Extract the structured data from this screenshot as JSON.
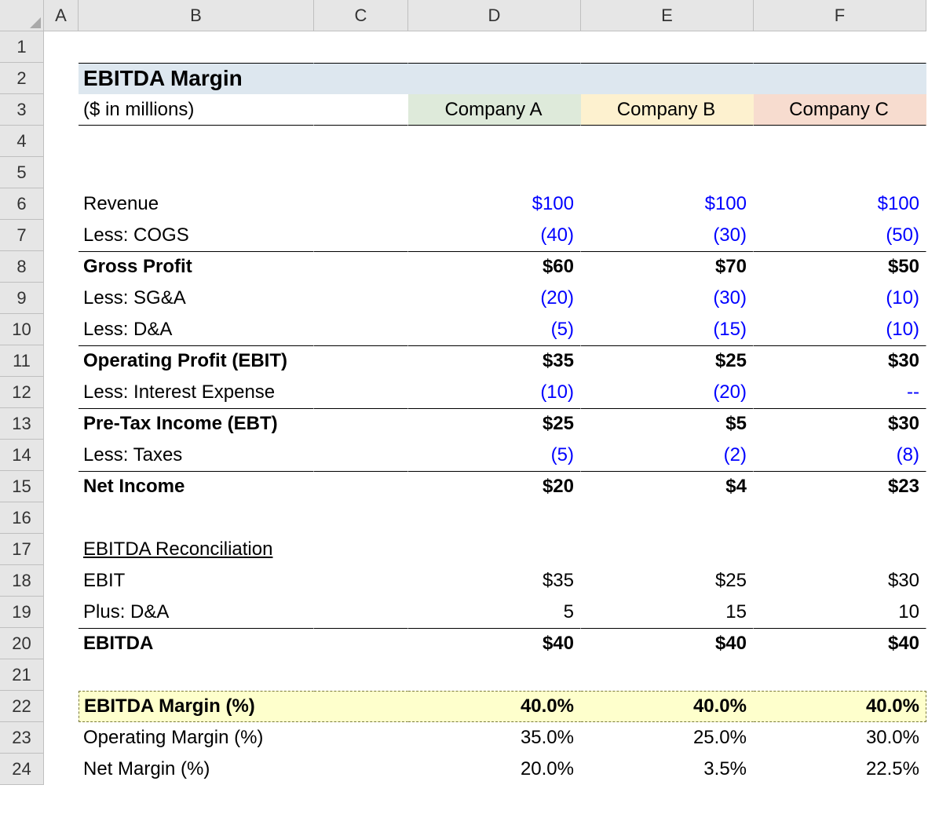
{
  "columns": [
    "A",
    "B",
    "C",
    "D",
    "E",
    "F"
  ],
  "rows": [
    "1",
    "2",
    "3",
    "4",
    "5",
    "6",
    "7",
    "8",
    "9",
    "10",
    "11",
    "12",
    "13",
    "14",
    "15",
    "16",
    "17",
    "18",
    "19",
    "20",
    "21",
    "22",
    "23",
    "24"
  ],
  "title": "EBITDA Margin",
  "subtitle": "($ in millions)",
  "companies": {
    "A": "Company A",
    "B": "Company B",
    "C": "Company C"
  },
  "lines": {
    "revenue": {
      "label": "Revenue",
      "A": "$100",
      "B": "$100",
      "C": "$100"
    },
    "cogs": {
      "label": "Less: COGS",
      "A": "(40)",
      "B": "(30)",
      "C": "(50)"
    },
    "gross": {
      "label": "Gross Profit",
      "A": "$60",
      "B": "$70",
      "C": "$50"
    },
    "sga": {
      "label": "Less: SG&A",
      "A": "(20)",
      "B": "(30)",
      "C": "(10)"
    },
    "da": {
      "label": "Less: D&A",
      "A": "(5)",
      "B": "(15)",
      "C": "(10)"
    },
    "ebit": {
      "label": "Operating Profit (EBIT)",
      "A": "$35",
      "B": "$25",
      "C": "$30"
    },
    "interest": {
      "label": "Less: Interest Expense",
      "A": "(10)",
      "B": "(20)",
      "C": "--"
    },
    "ebt": {
      "label": "Pre-Tax Income (EBT)",
      "A": "$25",
      "B": "$5",
      "C": "$30"
    },
    "taxes": {
      "label": "Less: Taxes",
      "A": "(5)",
      "B": "(2)",
      "C": "(8)"
    },
    "netincome": {
      "label": "Net Income",
      "A": "$20",
      "B": "$4",
      "C": "$23"
    },
    "recon_title": {
      "label": "EBITDA Reconciliation"
    },
    "recon_ebit": {
      "label": "EBIT",
      "A": "$35",
      "B": "$25",
      "C": "$30"
    },
    "recon_da": {
      "label": "Plus: D&A",
      "A": "5",
      "B": "15",
      "C": "10"
    },
    "ebitda": {
      "label": "EBITDA",
      "A": "$40",
      "B": "$40",
      "C": "$40"
    },
    "ebitda_margin": {
      "label": "EBITDA Margin (%)",
      "A": "40.0%",
      "B": "40.0%",
      "C": "40.0%"
    },
    "op_margin": {
      "label": "Operating Margin (%)",
      "A": "35.0%",
      "B": "25.0%",
      "C": "30.0%"
    },
    "net_margin": {
      "label": "Net Margin (%)",
      "A": "20.0%",
      "B": "3.5%",
      "C": "22.5%"
    }
  },
  "chart_data": {
    "type": "table",
    "title": "EBITDA Margin",
    "units": "$ in millions",
    "companies": [
      "Company A",
      "Company B",
      "Company C"
    ],
    "rows": [
      {
        "label": "Revenue",
        "values": [
          100,
          100,
          100
        ]
      },
      {
        "label": "Less: COGS",
        "values": [
          -40,
          -30,
          -50
        ]
      },
      {
        "label": "Gross Profit",
        "values": [
          60,
          70,
          50
        ]
      },
      {
        "label": "Less: SG&A",
        "values": [
          -20,
          -30,
          -10
        ]
      },
      {
        "label": "Less: D&A",
        "values": [
          -5,
          -15,
          -10
        ]
      },
      {
        "label": "Operating Profit (EBIT)",
        "values": [
          35,
          25,
          30
        ]
      },
      {
        "label": "Less: Interest Expense",
        "values": [
          -10,
          -20,
          null
        ]
      },
      {
        "label": "Pre-Tax Income (EBT)",
        "values": [
          25,
          5,
          30
        ]
      },
      {
        "label": "Less: Taxes",
        "values": [
          -5,
          -2,
          -8
        ]
      },
      {
        "label": "Net Income",
        "values": [
          20,
          4,
          23
        ]
      },
      {
        "label": "EBIT",
        "values": [
          35,
          25,
          30
        ]
      },
      {
        "label": "Plus: D&A",
        "values": [
          5,
          15,
          10
        ]
      },
      {
        "label": "EBITDA",
        "values": [
          40,
          40,
          40
        ]
      },
      {
        "label": "EBITDA Margin (%)",
        "values": [
          40.0,
          40.0,
          40.0
        ]
      },
      {
        "label": "Operating Margin (%)",
        "values": [
          35.0,
          25.0,
          30.0
        ]
      },
      {
        "label": "Net Margin (%)",
        "values": [
          20.0,
          3.5,
          22.5
        ]
      }
    ]
  }
}
